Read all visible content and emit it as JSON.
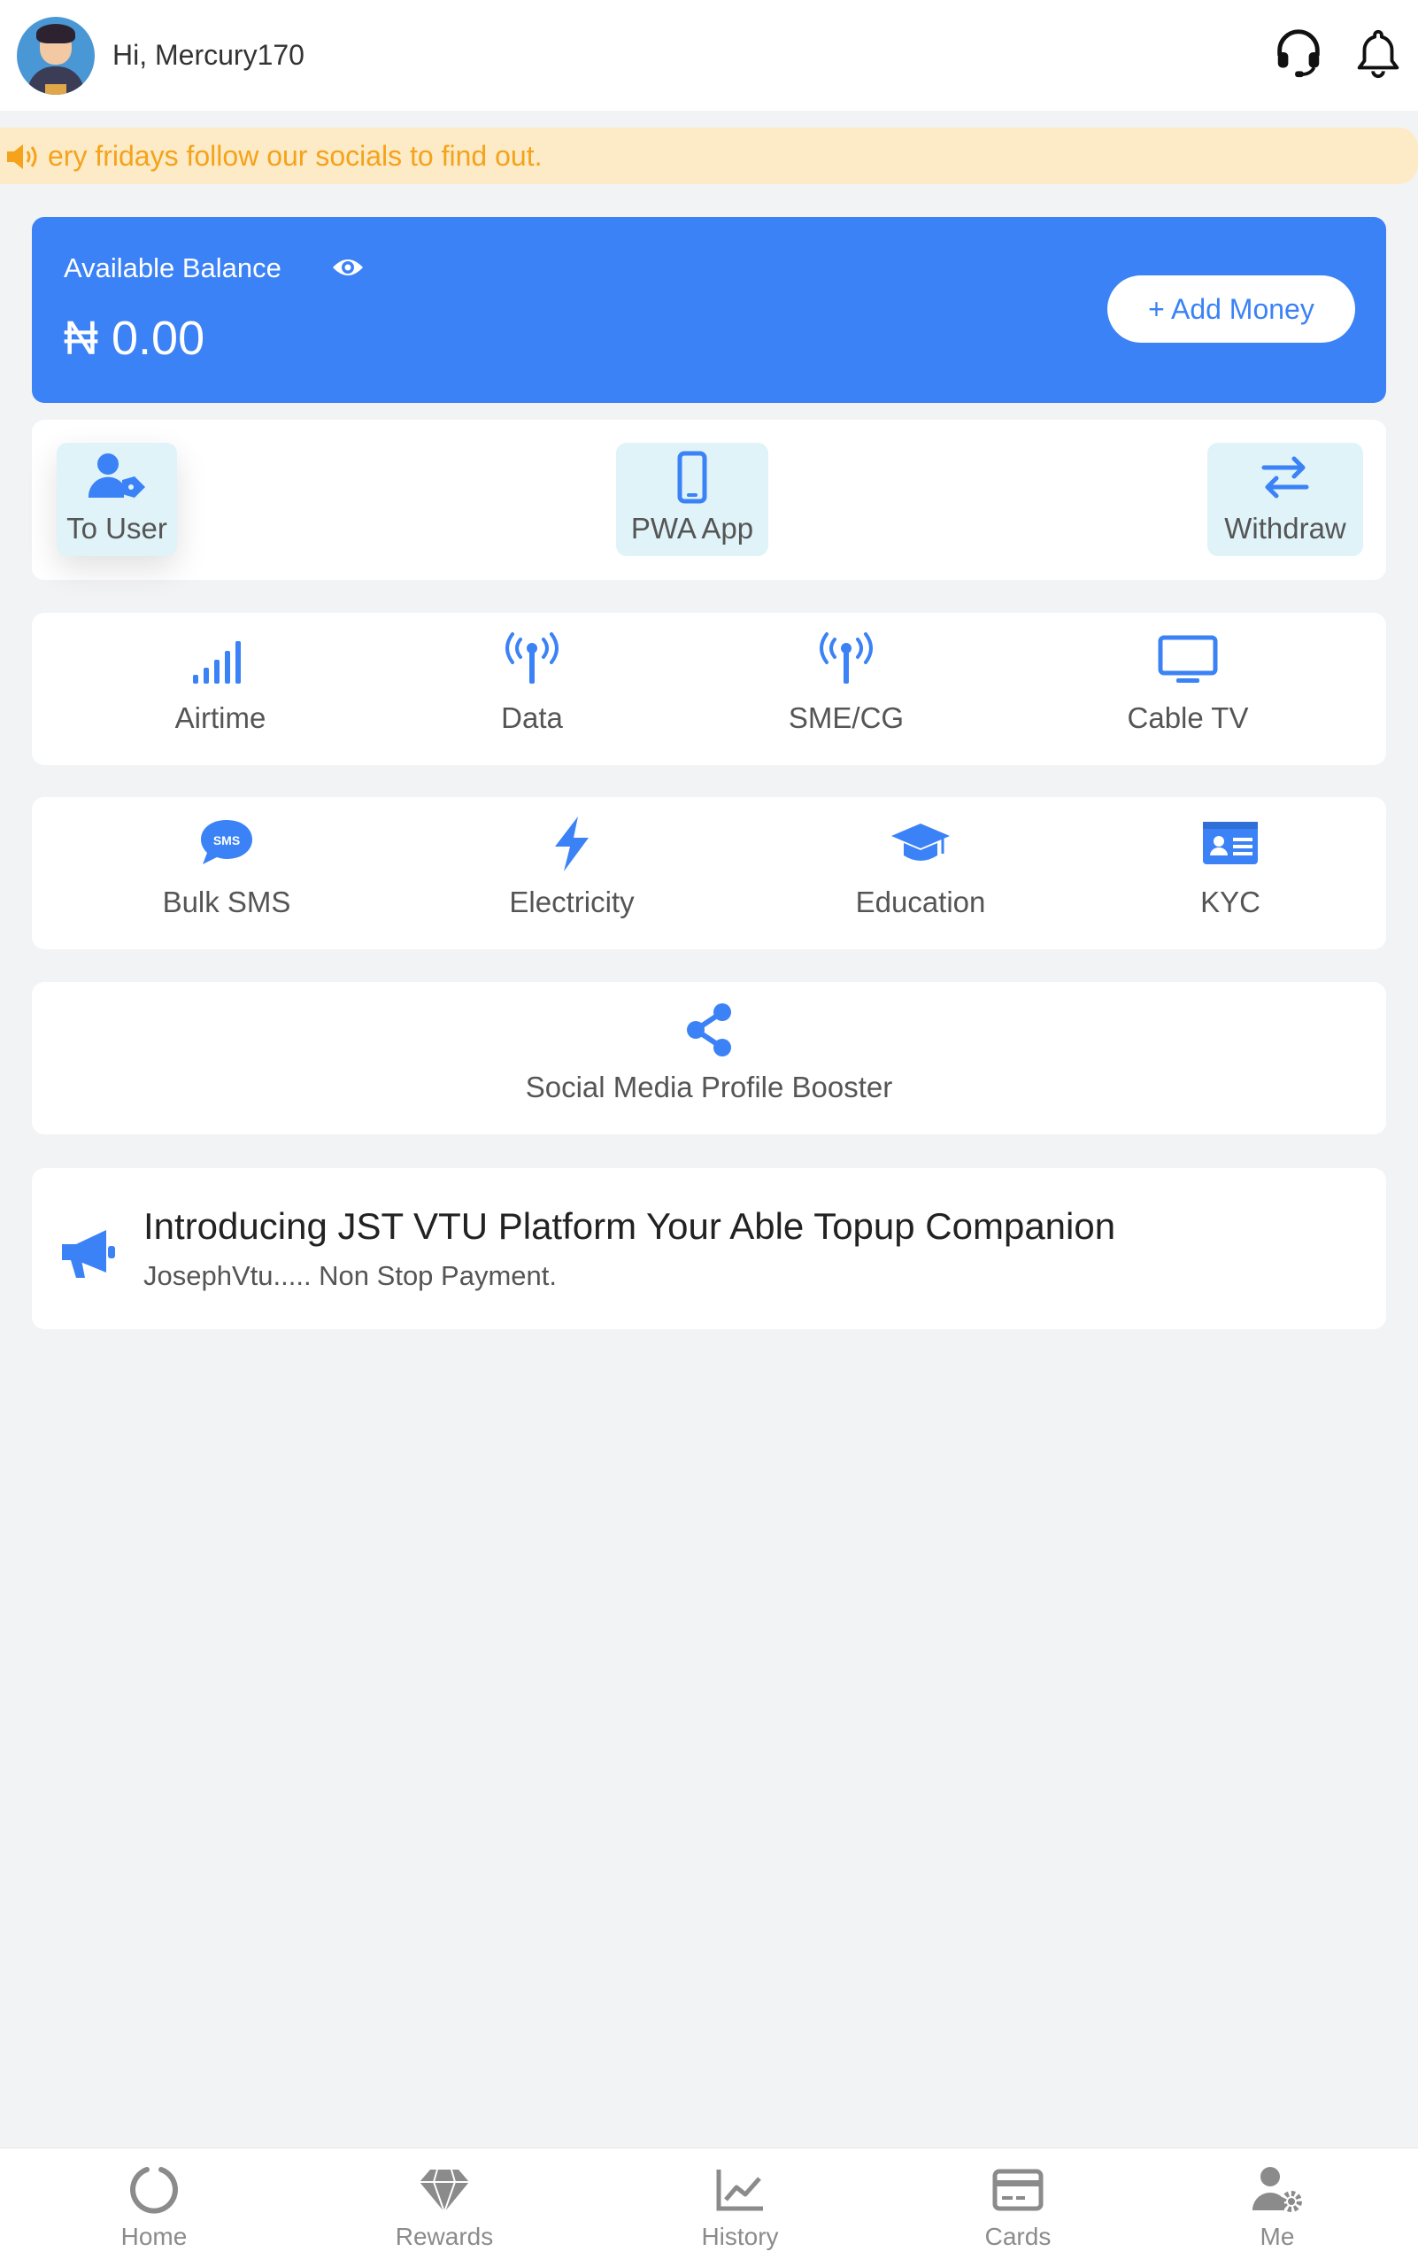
{
  "header": {
    "greeting": "Hi, Mercury170"
  },
  "marquee": {
    "text": "ery fridays follow our socials to find out."
  },
  "balance": {
    "label": "Available Balance",
    "amount": "₦ 0.00",
    "add_money_label": "+ Add Money"
  },
  "quick_actions": [
    {
      "label": "To User",
      "icon": "user-tag-icon"
    },
    {
      "label": "PWA App",
      "icon": "mobile-icon"
    },
    {
      "label": "Withdraw",
      "icon": "transfer-arrows-icon"
    }
  ],
  "services": [
    {
      "label": "Airtime",
      "icon": "signal-bars-icon"
    },
    {
      "label": "Data",
      "icon": "tower-broadcast-icon"
    },
    {
      "label": "SME/CG",
      "icon": "tower-broadcast-icon"
    },
    {
      "label": "Cable TV",
      "icon": "tv-icon"
    },
    {
      "label": "Bulk SMS",
      "icon": "sms-icon"
    },
    {
      "label": "Electricity",
      "icon": "bolt-icon"
    },
    {
      "label": "Education",
      "icon": "graduation-cap-icon"
    },
    {
      "label": "KYC",
      "icon": "id-card-icon"
    },
    {
      "label": "Social Media Profile Booster",
      "icon": "share-icon"
    }
  ],
  "announcement": {
    "title": "Introducing JST VTU Platform Your Able Topup Companion",
    "subtitle": "JosephVtu..... Non Stop Payment."
  },
  "bottom_nav": [
    {
      "label": "Home",
      "icon": "home-ring-icon"
    },
    {
      "label": "Rewards",
      "icon": "gem-icon"
    },
    {
      "label": "History",
      "icon": "chart-line-icon"
    },
    {
      "label": "Cards",
      "icon": "credit-card-icon"
    },
    {
      "label": "Me",
      "icon": "user-gear-icon"
    }
  ],
  "colors": {
    "primary": "#3b82f6",
    "marquee_bg": "#fdeac6",
    "marquee_text": "#f4a31a",
    "quick_bg": "#dff3f9",
    "page_bg": "#f2f3f5",
    "nav_icon": "#8b8b8b"
  }
}
